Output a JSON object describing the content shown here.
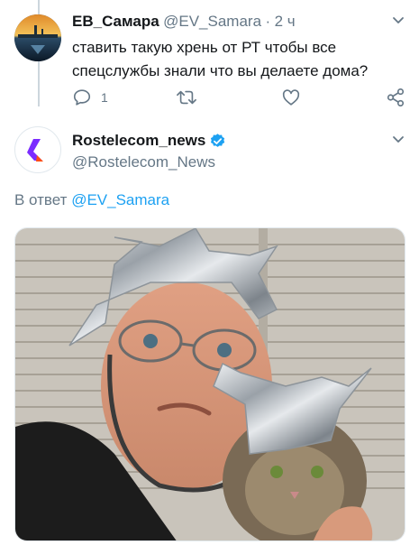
{
  "parent_tweet": {
    "display_name": "ЕВ_Самара",
    "handle": "@EV_Samara",
    "separator": "·",
    "time": "2 ч",
    "text_line1": "ставить такую хрень от РТ чтобы все",
    "text_line2": "спецслужбы знали что вы делаете дома?",
    "reply_count": "1",
    "icons": [
      "reply-icon",
      "retweet-icon",
      "like-icon",
      "share-icon",
      "chevron-down-icon"
    ]
  },
  "reply_tweet": {
    "display_name": "Rostelecom_news",
    "handle": "@Rostelecom_News",
    "verified": true,
    "reply_prefix": "В ответ",
    "reply_to": "@EV_Samara",
    "brand_color": "#7b2cff",
    "brand_accent": "#ff4f12"
  },
  "colors": {
    "text": "#14171a",
    "muted": "#657786",
    "link": "#1da1f2",
    "verified": "#1da1f2",
    "divider": "#ccd6dd"
  }
}
